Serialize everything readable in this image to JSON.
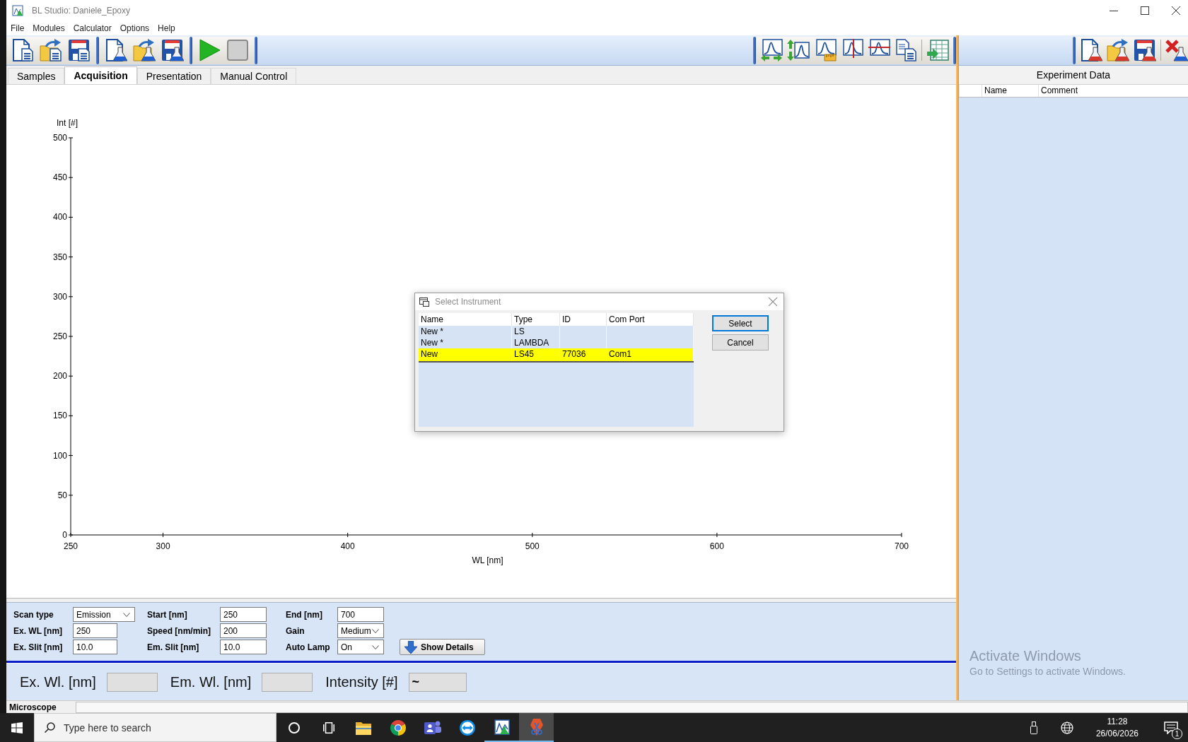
{
  "window": {
    "title": "BL Studio: Daniele_Epoxy"
  },
  "menu": [
    "File",
    "Modules",
    "Calculator",
    "Options",
    "Help"
  ],
  "tabs": [
    {
      "label": "Samples",
      "selected": false
    },
    {
      "label": "Acquisition",
      "selected": true
    },
    {
      "label": "Presentation",
      "selected": false
    },
    {
      "label": "Manual Control",
      "selected": false
    }
  ],
  "chart": {
    "chart_data": {
      "type": "line",
      "xlabel": "WL [nm]",
      "ylabel": "Int [#]",
      "xlim": [
        250,
        700
      ],
      "ylim": [
        0,
        500
      ],
      "xticks": [
        250,
        300,
        400,
        500,
        600,
        700
      ],
      "yticks": [
        0,
        50,
        100,
        150,
        200,
        250,
        300,
        350,
        400,
        450,
        500
      ]
    }
  },
  "scan_settings": [
    {
      "label": "Scan type",
      "kind": "dropdown",
      "value": "Emission"
    },
    {
      "label": "Start [nm]",
      "kind": "text",
      "value": "250"
    },
    {
      "label": "End [nm]",
      "kind": "text",
      "value": "700"
    },
    {
      "label": "Ex. WL [nm]",
      "kind": "text",
      "value": "250"
    },
    {
      "label": "Speed [nm/min]",
      "kind": "text",
      "value": "200"
    },
    {
      "label": "Gain",
      "kind": "dropdown",
      "value": "Medium"
    },
    {
      "label": "Ex. Slit [nm]",
      "kind": "text",
      "value": "10.0"
    },
    {
      "label": "Em. Slit [nm]",
      "kind": "text",
      "value": "10.0"
    },
    {
      "label": "Auto Lamp",
      "kind": "dropdown",
      "value": "On"
    }
  ],
  "show_details": {
    "label": "Show Details"
  },
  "readouts": [
    {
      "label": "Ex. Wl. [nm]"
    },
    {
      "label": "Em. Wl. [nm]"
    },
    {
      "label": "Intensity [#]",
      "value": "~"
    }
  ],
  "experiment_data": {
    "title": "Experiment Data",
    "columns": [
      "Name",
      "Comment"
    ]
  },
  "activation_notice": {
    "title": "Activate Windows",
    "text": "Go to Settings to activate Windows."
  },
  "status_bar": {
    "label": "Microscope"
  },
  "dialog": {
    "title": "Select Instrument",
    "columns": [
      "Name",
      "Type",
      "ID",
      "Com Port"
    ],
    "rows": [
      {
        "name": "New *",
        "type": "LS",
        "selected": false
      },
      {
        "name": "New *",
        "type": "LAMBDA",
        "selected": false
      },
      {
        "name": "New",
        "type": "LS45",
        "id": "77036",
        "com_port": "Com1",
        "selected": true
      }
    ],
    "buttons": [
      {
        "label": "Select",
        "focused": true
      },
      {
        "label": "Cancel",
        "focused": false
      }
    ]
  },
  "taskbar": {
    "search": {
      "placeholder": "Type here to search"
    },
    "apps": [
      {
        "kind": "files",
        "running": false,
        "selected": false
      },
      {
        "kind": "browser",
        "running": false,
        "selected": false
      },
      {
        "kind": "chat",
        "running": false,
        "selected": false
      },
      {
        "kind": "remote",
        "running": false,
        "selected": false
      },
      {
        "kind": "studio",
        "running": true,
        "selected": false
      },
      {
        "kind": "snip",
        "running": true,
        "selected": true
      }
    ],
    "time": "11:28",
    "date": "26/06/2026",
    "notifications": "1"
  }
}
